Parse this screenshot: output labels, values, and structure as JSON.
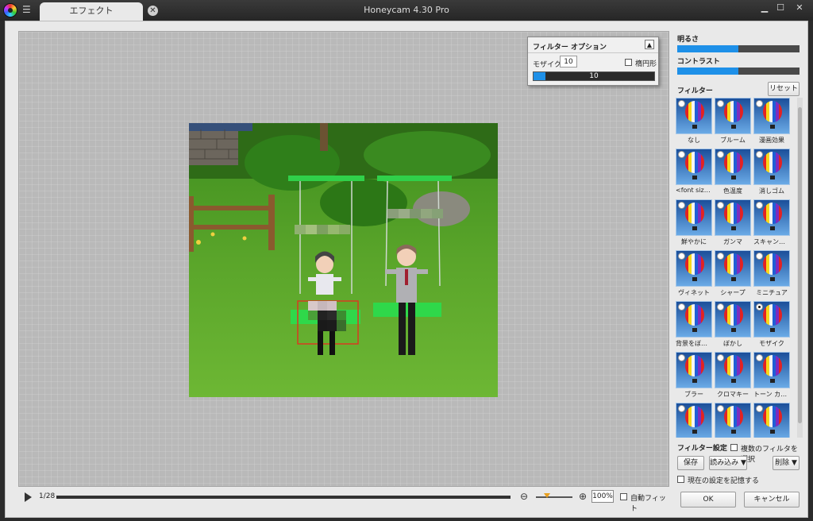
{
  "window": {
    "tab_label": "エフェクト",
    "title": "Honeycam 4.30 Pro",
    "minimize": "▁",
    "maximize": "☐",
    "close": "✕"
  },
  "filter_option": {
    "title": "フィルター オプション",
    "collapse": "▲",
    "mosaic_label": "モザイク",
    "mosaic_value": "10",
    "ellipse_label": "楕円形",
    "ellipse_checked": false,
    "slider_text": "10",
    "slider_fraction": 0.1
  },
  "playback": {
    "frame": "1/28",
    "zoom_out": "⊖",
    "zoom_in": "⊕",
    "zoom_level": "100%",
    "zoom_fraction": 0.3,
    "autofit_label": "自動フィット",
    "autofit_checked": false
  },
  "panel": {
    "brightness_label": "明るさ",
    "brightness_fraction": 0.5,
    "contrast_label": "コントラスト",
    "contrast_fraction": 0.5,
    "filter_label": "フィルター",
    "reset_label": "リセット",
    "filters": [
      {
        "label": "なし",
        "selected": false
      },
      {
        "label": "ブルーム",
        "selected": false
      },
      {
        "label": "漫画効果",
        "selected": false
      },
      {
        "label": "<font size...",
        "selected": false
      },
      {
        "label": "色温度",
        "selected": false
      },
      {
        "label": "消しゴム",
        "selected": false
      },
      {
        "label": "鮮やかに",
        "selected": false
      },
      {
        "label": "ガンマ",
        "selected": false
      },
      {
        "label": "スキャンライン",
        "selected": false
      },
      {
        "label": "ヴィネット",
        "selected": false
      },
      {
        "label": "シャープ",
        "selected": false
      },
      {
        "label": "ミニチュア",
        "selected": false
      },
      {
        "label": "背景をぼかす",
        "selected": false
      },
      {
        "label": "ぼかし",
        "selected": false
      },
      {
        "label": "モザイク",
        "selected": true
      },
      {
        "label": "ブラー",
        "selected": false
      },
      {
        "label": "クロマキー",
        "selected": false
      },
      {
        "label": "トーン カーブ",
        "selected": false
      },
      {
        "label": "",
        "selected": false
      },
      {
        "label": "",
        "selected": false
      },
      {
        "label": "",
        "selected": false
      }
    ],
    "filter_settings_label": "フィルター設定",
    "multi_select_label": "複数のフィルタを選択",
    "save_label": "保存",
    "load_label": "読み込み ▼",
    "delete_label": "削除 ▼",
    "remember_label": "現在の設定を記憶する",
    "ok_label": "OK",
    "cancel_label": "キャンセル"
  }
}
